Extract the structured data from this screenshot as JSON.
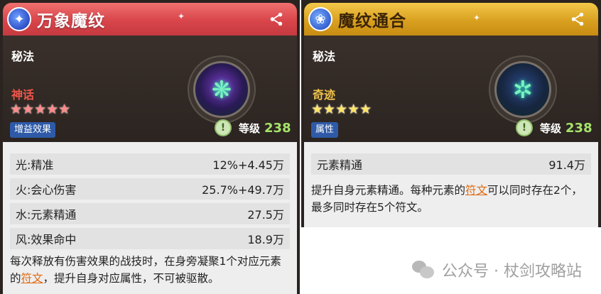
{
  "left_card": {
    "title": "万象魔纹",
    "category": "秘法",
    "rarity": "神话",
    "stars": "★★★★★",
    "tag": "增益效果",
    "level_label": "等级",
    "level_value": "238",
    "stats": [
      {
        "name": "光:精准",
        "value": "12%+4.45万"
      },
      {
        "name": "火:会心伤害",
        "value": "25.7%+49.7万"
      },
      {
        "name": "水:元素精通",
        "value": "27.5万"
      },
      {
        "name": "风:效果命中",
        "value": "18.9万"
      }
    ],
    "desc_a": "每次释放有伤害效果的战技时，在身旁凝聚1个对应元素的",
    "desc_kw": "符文",
    "desc_b": "，提升自身对应属性，不可被驱散。"
  },
  "right_card": {
    "title": "魔纹通合",
    "category": "秘法",
    "rarity": "奇迹",
    "stars": "★★★★★",
    "tag": "属性",
    "level_label": "等级",
    "level_value": "238",
    "stats": [
      {
        "name": "元素精通",
        "value": "91.4万"
      }
    ],
    "desc_a": "提升自身元素精通。每种元素的",
    "desc_kw": "符文",
    "desc_b": "可以同时存在2个，最多同时存在5个符文。"
  },
  "watermark": {
    "text": "公众号 · 杖剑攻略站"
  },
  "colors": {
    "left_header": "#d8454a",
    "right_header": "#d9a020",
    "keyword": "#e06a12",
    "level_value": "#a6e36a"
  },
  "icons": [
    "share-icon",
    "level-icon",
    "skill-emblem-icon",
    "wechat-icon"
  ]
}
